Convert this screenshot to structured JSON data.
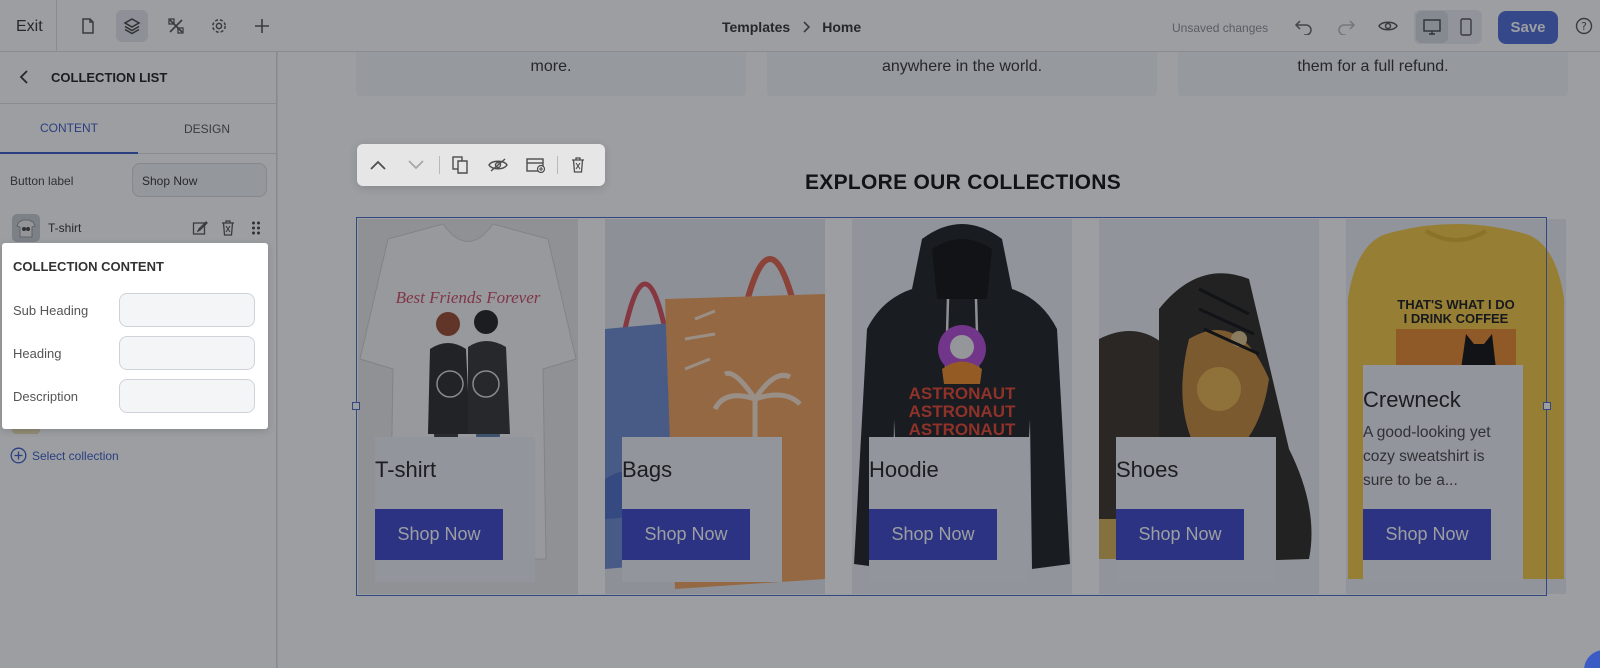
{
  "topbar": {
    "exit_label": "Exit",
    "breadcrumb": [
      "Templates",
      "Home"
    ],
    "status": "Unsaved changes",
    "save_label": "Save"
  },
  "sidebar": {
    "title": "COLLECTION LIST",
    "tabs": [
      "CONTENT",
      "DESIGN"
    ],
    "button_label_field": {
      "label": "Button label",
      "value": "Shop Now"
    },
    "collections": [
      {
        "name": "T-shirt"
      }
    ],
    "select_collection": "Select collection"
  },
  "popover": {
    "title": "COLLECTION CONTENT",
    "fields": [
      {
        "label": "Sub Heading",
        "value": ""
      },
      {
        "label": "Heading",
        "value": ""
      },
      {
        "label": "Description",
        "value": ""
      }
    ]
  },
  "canvas": {
    "features": [
      "more.",
      "anywhere in the world.",
      "them for a full refund."
    ],
    "section_title": "EXPLORE OUR COLLECTIONS",
    "cards": [
      {
        "title": "T-shirt",
        "description": "",
        "button": "Shop Now"
      },
      {
        "title": "Bags",
        "description": "",
        "button": "Shop Now"
      },
      {
        "title": "Hoodie",
        "description": "",
        "button": "Shop Now"
      },
      {
        "title": "Shoes",
        "description": "",
        "button": "Shop Now"
      },
      {
        "title": "Crewneck",
        "description": "A good-looking yet cozy sweatshirt is sure to be a...",
        "button": "Shop Now"
      }
    ]
  },
  "product_art_text": {
    "tshirt": "Best Friends Forever",
    "hoodie": [
      "ASTRONAUT",
      "ASTRONAUT",
      "ASTRONAUT"
    ],
    "crewneck": [
      "THAT'S WHAT I DO",
      "I DRINK COFFEE"
    ]
  },
  "colors": {
    "accent": "#3b5cc4",
    "save": "#4f6bd6",
    "shop_button": "#3d47c9",
    "selection": "#4a69c8"
  }
}
